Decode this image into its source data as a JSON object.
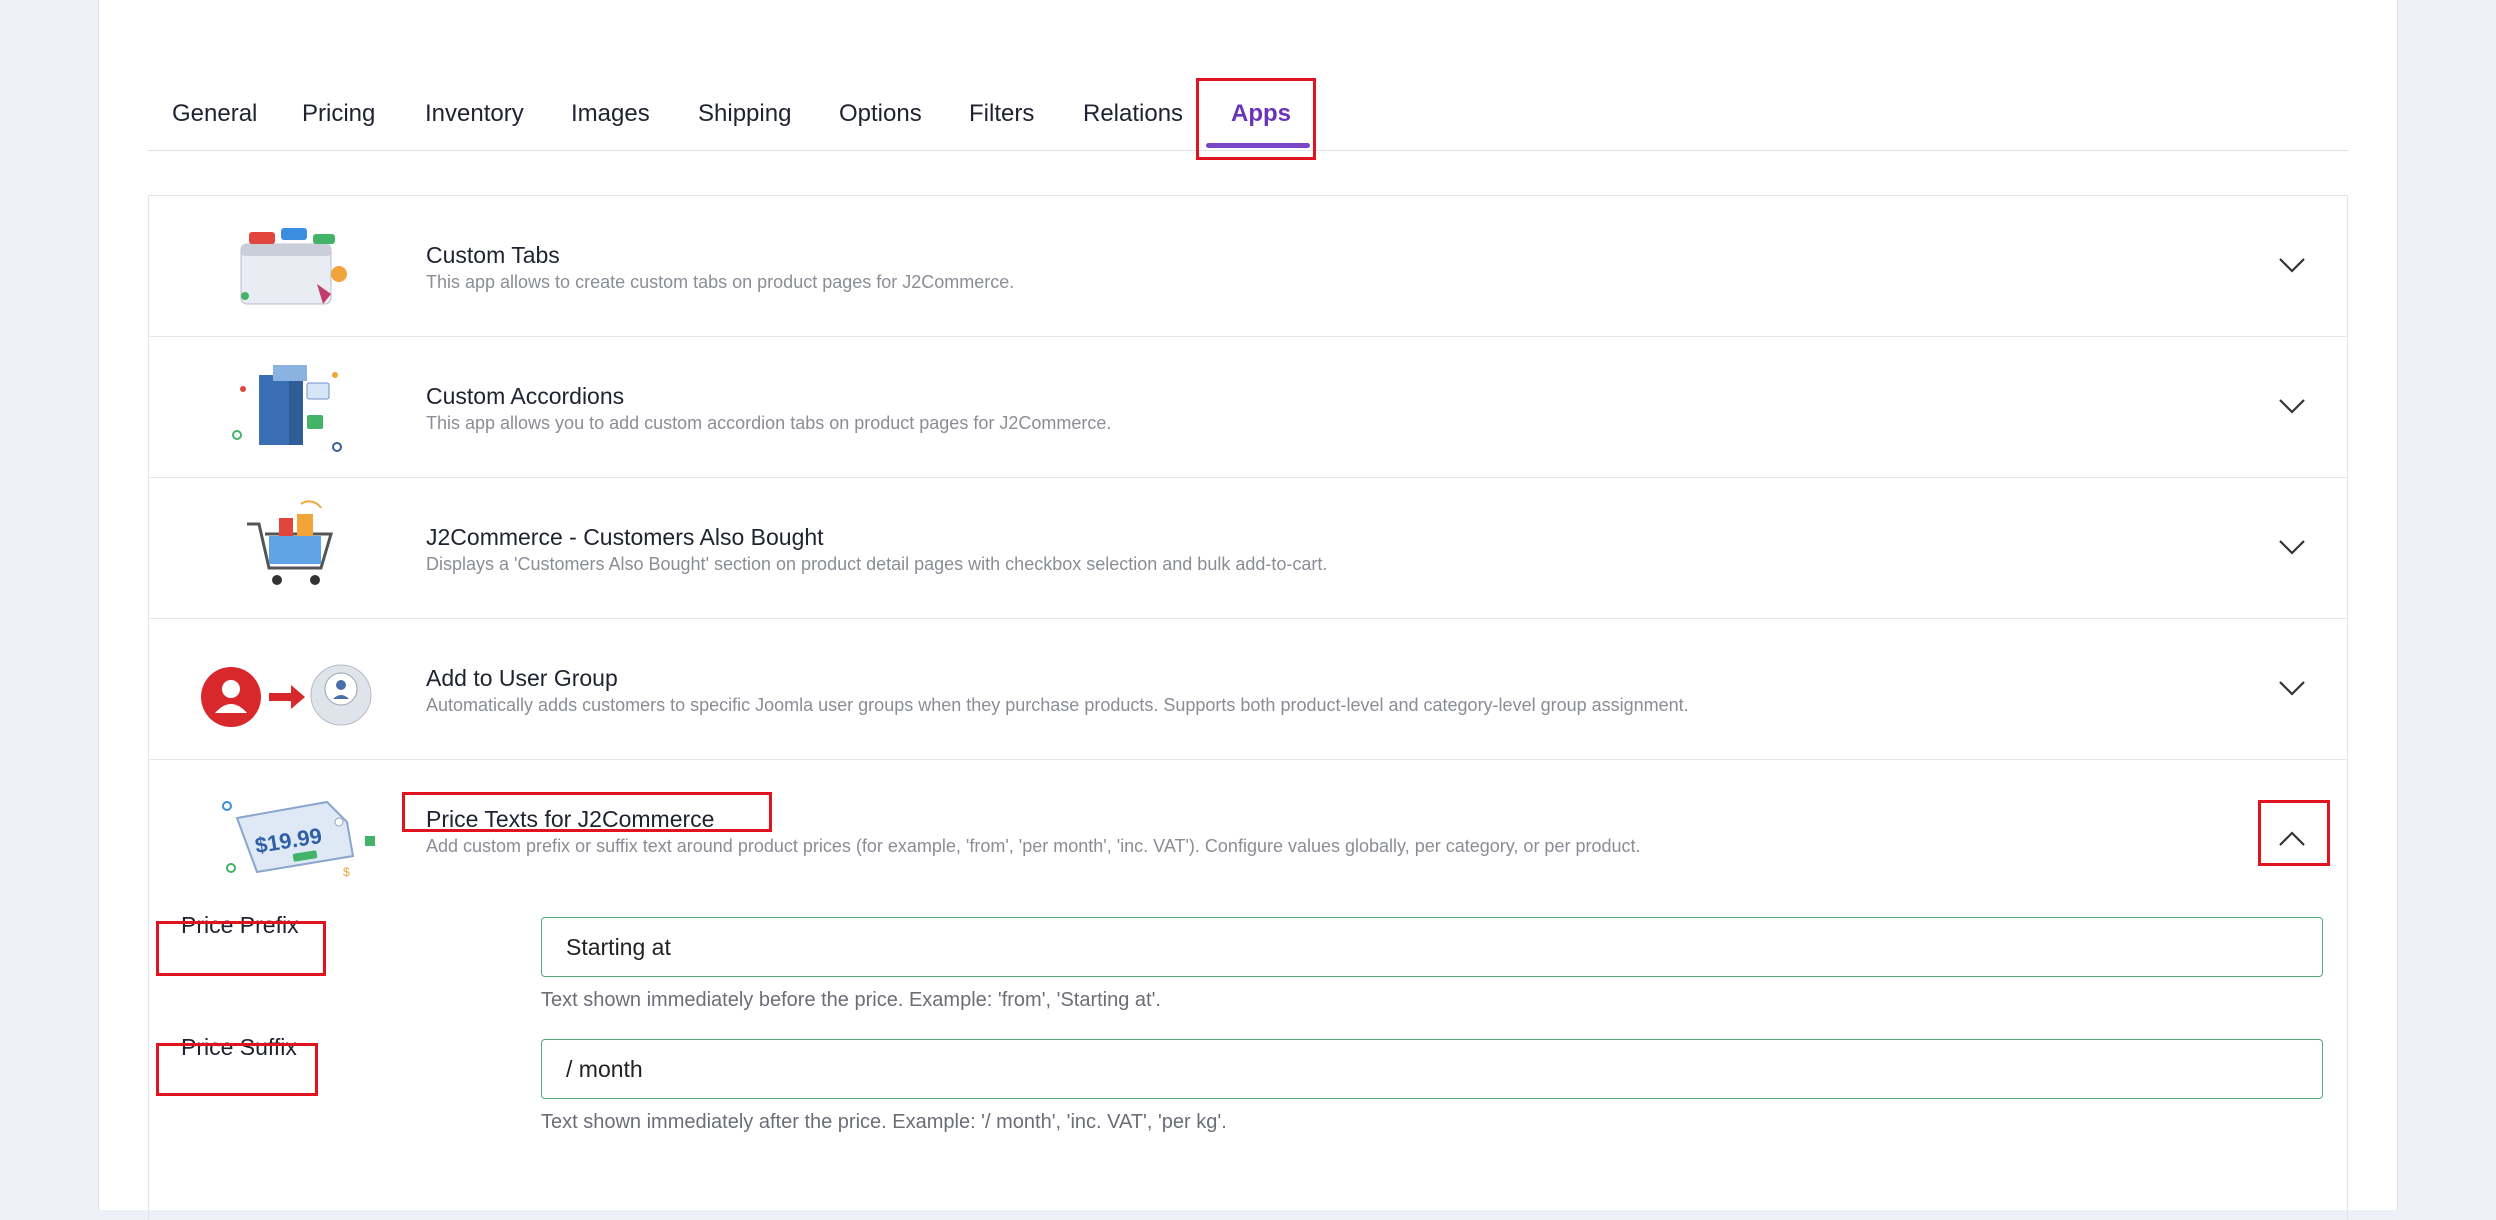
{
  "tabs": [
    {
      "label": "General"
    },
    {
      "label": "Pricing"
    },
    {
      "label": "Inventory"
    },
    {
      "label": "Images"
    },
    {
      "label": "Shipping"
    },
    {
      "label": "Options"
    },
    {
      "label": "Filters"
    },
    {
      "label": "Relations"
    },
    {
      "label": "Apps"
    }
  ],
  "active_tab": "Apps",
  "apps": [
    {
      "title": "Custom Tabs",
      "description": "This app allows to create custom tabs on product pages for J2Commerce."
    },
    {
      "title": "Custom Accordions",
      "description": "This app allows you to add custom accordion tabs on product pages for J2Commerce."
    },
    {
      "title": "J2Commerce - Customers Also Bought",
      "description": "Displays a 'Customers Also Bought' section on product detail pages with checkbox selection and bulk add-to-cart."
    },
    {
      "title": "Add to User Group",
      "description": "Automatically adds customers to specific Joomla user groups when they purchase products. Supports both product-level and category-level group assignment."
    },
    {
      "title": "Price Texts for J2Commerce",
      "description": "Add custom prefix or suffix text around product prices (for example, 'from', 'per month', 'inc. VAT'). Configure values globally, per category, or per product.",
      "price_tag_text": "$19.99"
    }
  ],
  "fields": {
    "prefix": {
      "label": "Price Prefix",
      "value": "Starting at",
      "help": "Text shown immediately before the price. Example: 'from', 'Starting at'."
    },
    "suffix": {
      "label": "Price Suffix",
      "value": "/ month",
      "help": "Text shown immediately after the price. Example: '/ month', 'inc. VAT', 'per kg'."
    }
  },
  "colors": {
    "accent": "#6a33b8",
    "highlight": "#e0131f",
    "input_border": "#5aa77a"
  }
}
